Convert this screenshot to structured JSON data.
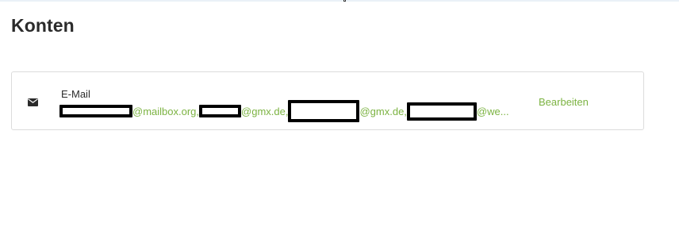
{
  "page": {
    "title": "Konten"
  },
  "accounts": {
    "email": {
      "icon": "envelope-icon",
      "label": "E-Mail",
      "entries": [
        {
          "redacted": true,
          "domain": "@mailbox.org,"
        },
        {
          "redacted": true,
          "domain": "@gmx.de,"
        },
        {
          "redacted": true,
          "domain": "@gmx.de,"
        },
        {
          "redacted": true,
          "domain": "@we..."
        }
      ],
      "edit_label": "Bearbeiten"
    }
  },
  "colors": {
    "accent": "#7cb342",
    "text": "#2b2b2b",
    "border": "#dcdcdc",
    "redaction": "#000000"
  }
}
